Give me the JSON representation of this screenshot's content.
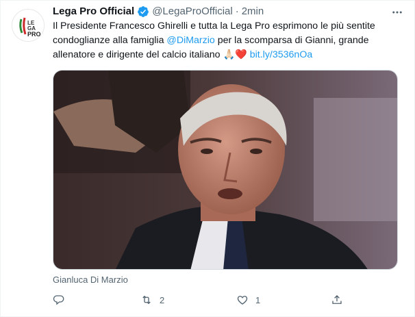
{
  "tweet": {
    "display_name": "Lega Pro Official",
    "handle": "@LegaProOfficial",
    "separator": "·",
    "time": "2min",
    "more_icon": "more-icon",
    "avatar_logo_text": "LEGA PRO",
    "text_before_mention": "Il Presidente Francesco Ghirelli e tutta la Lega Pro esprimono le più sentite condoglianze alla famiglia ",
    "mention": "@DiMarzio",
    "text_after_mention": " per la scomparsa di Gianni, grande allenatore e dirigente del calcio italiano ",
    "emojis": "🙏🏻❤️",
    "link": "bit.ly/3536nOa",
    "media_caption": "Gianluca Di Marzio"
  },
  "actions": {
    "reply": {
      "icon": "reply-icon",
      "count": ""
    },
    "retweet": {
      "icon": "retweet-icon",
      "count": "2"
    },
    "like": {
      "icon": "like-icon",
      "count": "1"
    },
    "share": {
      "icon": "share-icon",
      "count": ""
    }
  },
  "colors": {
    "link": "#1d9bf0",
    "secondary_text": "#536471",
    "verified": "#1d9bf0"
  }
}
